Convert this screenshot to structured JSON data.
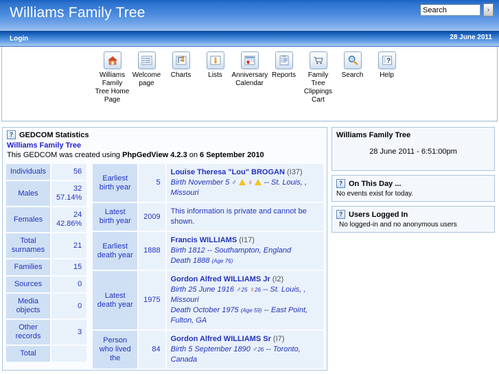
{
  "header": {
    "site_title": "Williams Family Tree",
    "search_placeholder": "Search",
    "search_value": "Search",
    "search_go_label": "›",
    "login_label": "Login",
    "date": "28 June 2011"
  },
  "toolbar": {
    "items": [
      {
        "label": "Williams Family Tree Home Page",
        "icon": "home-icon"
      },
      {
        "label": "Welcome page",
        "icon": "list-lines-icon"
      },
      {
        "label": "Charts",
        "icon": "charts-icon"
      },
      {
        "label": "Lists",
        "icon": "person-icon"
      },
      {
        "label": "Anniversary Calendar",
        "icon": "calendar-heart-icon"
      },
      {
        "label": "Reports",
        "icon": "clipboard-icon"
      },
      {
        "label": "Family Tree Clippings Cart",
        "icon": "cart-icon"
      },
      {
        "label": "Search",
        "icon": "magnifier-icon"
      },
      {
        "label": "Help",
        "icon": "question-icon"
      }
    ]
  },
  "gedcom": {
    "help_glyph": "?",
    "title": "GEDCOM Statistics",
    "tree_link": "Williams Family Tree",
    "created_prefix": "This GEDCOM was created using ",
    "created_app": "PhpGedView 4.2.3",
    "created_mid": " on ",
    "created_date": "6 September 2010"
  },
  "counts": {
    "rows": [
      {
        "label": "Individuals",
        "value": "56",
        "pct": ""
      },
      {
        "label": "Males",
        "value": "32",
        "pct": "57.14%"
      },
      {
        "label": "Females",
        "value": "24",
        "pct": "42.86%"
      },
      {
        "label": "Total surnames",
        "value": "21",
        "pct": ""
      },
      {
        "label": "Families",
        "value": "15",
        "pct": ""
      },
      {
        "label": "Sources",
        "value": "0",
        "pct": ""
      },
      {
        "label": "Media objects",
        "value": "0",
        "pct": ""
      },
      {
        "label": "Other records",
        "value": "3",
        "pct": ""
      },
      {
        "label": "Total",
        "value": "",
        "pct": ""
      }
    ]
  },
  "years": {
    "rows": [
      {
        "label": "Earliest birth year",
        "value": "5",
        "person": "Louise Theresa \"Lou\" BROGAN",
        "pid": "(I37)",
        "private": false,
        "lines": [
          {
            "text": "Birth November 5",
            "male_count": "",
            "female_count": "",
            "warn": 2,
            "place": "-- St. Louis, , Missouri"
          }
        ]
      },
      {
        "label": "Latest birth year",
        "value": "2009",
        "person": "",
        "pid": "",
        "private": true,
        "private_text": "This information is private and cannot be shown.",
        "lines": []
      },
      {
        "label": "Earliest death year",
        "value": "1888",
        "person": "Francis WILLIAMS",
        "pid": "(I17)",
        "private": false,
        "lines": [
          {
            "text": "Birth 1812 -- Southampton, England"
          },
          {
            "text": "Death 1888",
            "age": "(Age 76)"
          }
        ]
      },
      {
        "label": "Latest death year",
        "value": "1975",
        "person": "Gordon Alfred WILLIAMS Jr",
        "pid": "(I2)",
        "private": false,
        "lines": [
          {
            "text": "Birth 25 June 1916",
            "male_count": "25",
            "female_count": "26",
            "place": "-- St. Louis, , Missouri"
          },
          {
            "text": "Death October 1975",
            "age": "(Age 59)",
            "place": "-- East Point, Fulton, GA"
          }
        ]
      },
      {
        "label": "Person who lived the",
        "value": "84",
        "person": "Gordon Alfred WILLIAMS Sr",
        "pid": "(I7)",
        "private": false,
        "lines": [
          {
            "text": "Birth 5 September 1890",
            "male_count": "26",
            "place": "-- Toronto, Canada"
          }
        ]
      }
    ]
  },
  "sidebar": {
    "clock_block": {
      "title": "Williams Family Tree",
      "datetime": "28 June 2011 - 6:51:00pm"
    },
    "on_this_day": {
      "help_glyph": "?",
      "title": "On This Day ...",
      "body": "No events exist for today."
    },
    "users_logged_in": {
      "help_glyph": "?",
      "title": "Users Logged In",
      "body": "No logged-in and no anonymous users"
    }
  },
  "colors": {
    "header_blue": "#2f74cf",
    "link_blue": "#2233cc",
    "panel_bg": "#f4f8fd",
    "panel_border": "#a8c4e0",
    "label_cell": "#cfe0f5",
    "value_cell": "#e9f1fb"
  }
}
